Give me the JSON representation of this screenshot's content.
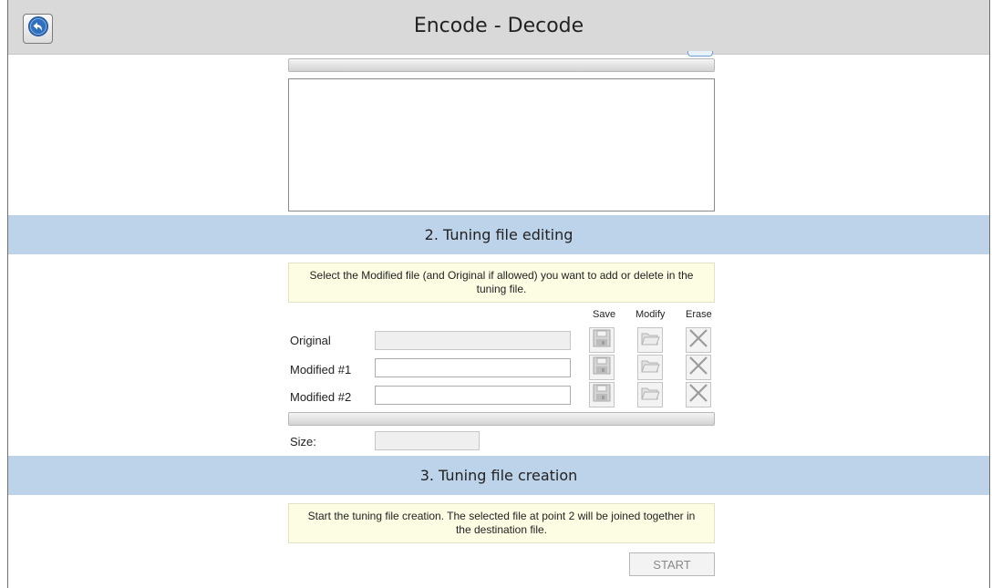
{
  "window": {
    "title": "Encode - Decode"
  },
  "section1": {
    "text_content": ""
  },
  "section2": {
    "header": "2. Tuning file editing",
    "hint": "Select the Modified file (and Original if allowed) you want to add or delete in the tuning file.",
    "columns": {
      "save": "Save",
      "modify": "Modify",
      "erase": "Erase"
    },
    "rows": [
      {
        "label": "Original",
        "value": ""
      },
      {
        "label": "Modified #1",
        "value": ""
      },
      {
        "label": "Modified #2",
        "value": ""
      }
    ],
    "size_label": "Size:",
    "size_value": ""
  },
  "section3": {
    "header": "3. Tuning file creation",
    "hint": "Start the tuning file creation. The selected file at point 2 will be joined together in the destination file.",
    "start_label": "START"
  },
  "icons": {
    "back": "back-arrow-icon",
    "save": "floppy-disk-icon",
    "modify": "folder-open-icon",
    "erase": "x-cross-icon"
  },
  "colors": {
    "titlebar": "#d9d9d9",
    "section_header": "#bdd3ea",
    "hint_background": "#fdfde3",
    "back_icon": "#2e6fbf"
  }
}
